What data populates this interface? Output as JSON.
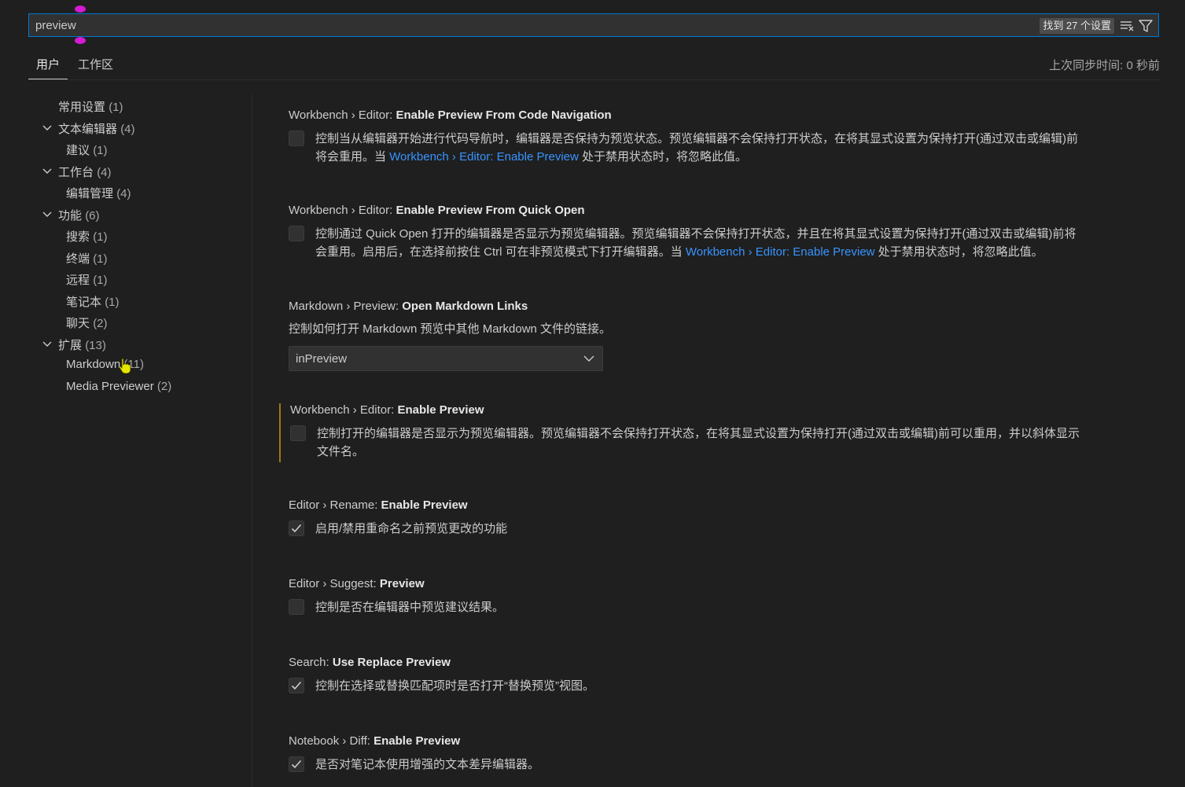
{
  "search": {
    "value": "preview",
    "result_count": "找到 27 个设置"
  },
  "tabs": [
    {
      "label": "用户"
    },
    {
      "label": "工作区"
    }
  ],
  "sync_status": "上次同步时间: 0 秒前",
  "toc": [
    {
      "label": "常用设置",
      "count": "(1)"
    },
    {
      "label": "文本编辑器",
      "count": "(4)"
    },
    {
      "label": "建议",
      "count": "(1)"
    },
    {
      "label": "工作台",
      "count": "(4)"
    },
    {
      "label": "编辑管理",
      "count": "(4)"
    },
    {
      "label": "功能",
      "count": "(6)"
    },
    {
      "label": "搜索",
      "count": "(1)"
    },
    {
      "label": "终端",
      "count": "(1)"
    },
    {
      "label": "远程",
      "count": "(1)"
    },
    {
      "label": "笔记本",
      "count": "(1)"
    },
    {
      "label": "聊天",
      "count": "(2)"
    },
    {
      "label": "扩展",
      "count": "(13)"
    },
    {
      "label": "Markdown",
      "count": "(11)"
    },
    {
      "label": "Media Previewer",
      "count": "(2)"
    }
  ],
  "settings": [
    {
      "category": "Workbench › Editor: ",
      "name": "Enable Preview From Code Navigation",
      "checked": false,
      "desc_line1": "控制当从编辑器开始进行代码导航时，编辑器是否保持为预览状态。预览编辑器不会保持打开状态，在将其显式设置为保持打开(通过双击或编辑)前",
      "desc_line2_pre": "将会重用。当 ",
      "desc_link": "Workbench › Editor: Enable Preview",
      "desc_line2_post": " 处于禁用状态时，将忽略此值。"
    },
    {
      "category": "Workbench › Editor: ",
      "name": "Enable Preview From Quick Open",
      "checked": false,
      "desc_line1": "控制通过 Quick Open 打开的编辑器是否显示为预览编辑器。预览编辑器不会保持打开状态，并且在将其显式设置为保持打开(通过双击或编辑)前将",
      "desc_line2_pre": "会重用。启用后，在选择前按住 Ctrl 可在非预览模式下打开编辑器。当 ",
      "desc_link": "Workbench › Editor: Enable Preview",
      "desc_line2_post": " 处于禁用状态时，将忽略此值。"
    },
    {
      "category": "Markdown › Preview: ",
      "name": "Open Markdown Links",
      "desc": "控制如何打开 Markdown 预览中其他 Markdown 文件的链接。",
      "select_value": "inPreview"
    },
    {
      "category": "Workbench › Editor: ",
      "name": "Enable Preview",
      "checked": false,
      "desc_line1": "控制打开的编辑器是否显示为预览编辑器。预览编辑器不会保持打开状态，在将其显式设置为保持打开(通过双击或编辑)前可以重用，并以斜体显示",
      "desc_line2": "文件名。"
    },
    {
      "category": "Editor › Rename: ",
      "name": "Enable Preview",
      "checked": true,
      "desc": "启用/禁用重命名之前预览更改的功能"
    },
    {
      "category": "Editor › Suggest: ",
      "name": "Preview",
      "checked": false,
      "desc": "控制是否在编辑器中预览建议结果。"
    },
    {
      "category": "Search: ",
      "name": "Use Replace Preview",
      "checked": true,
      "desc": "控制在选择或替换匹配项时是否打开“替换预览”视图。"
    },
    {
      "category": "Notebook › Diff: ",
      "name": "Enable Preview",
      "checked": true,
      "desc": "是否对笔记本使用增强的文本差异编辑器。"
    }
  ],
  "colors": {
    "accent": "#0078d4",
    "link": "#3794ff",
    "focus_bar": "#a17717",
    "background": "#1f1f1f"
  }
}
